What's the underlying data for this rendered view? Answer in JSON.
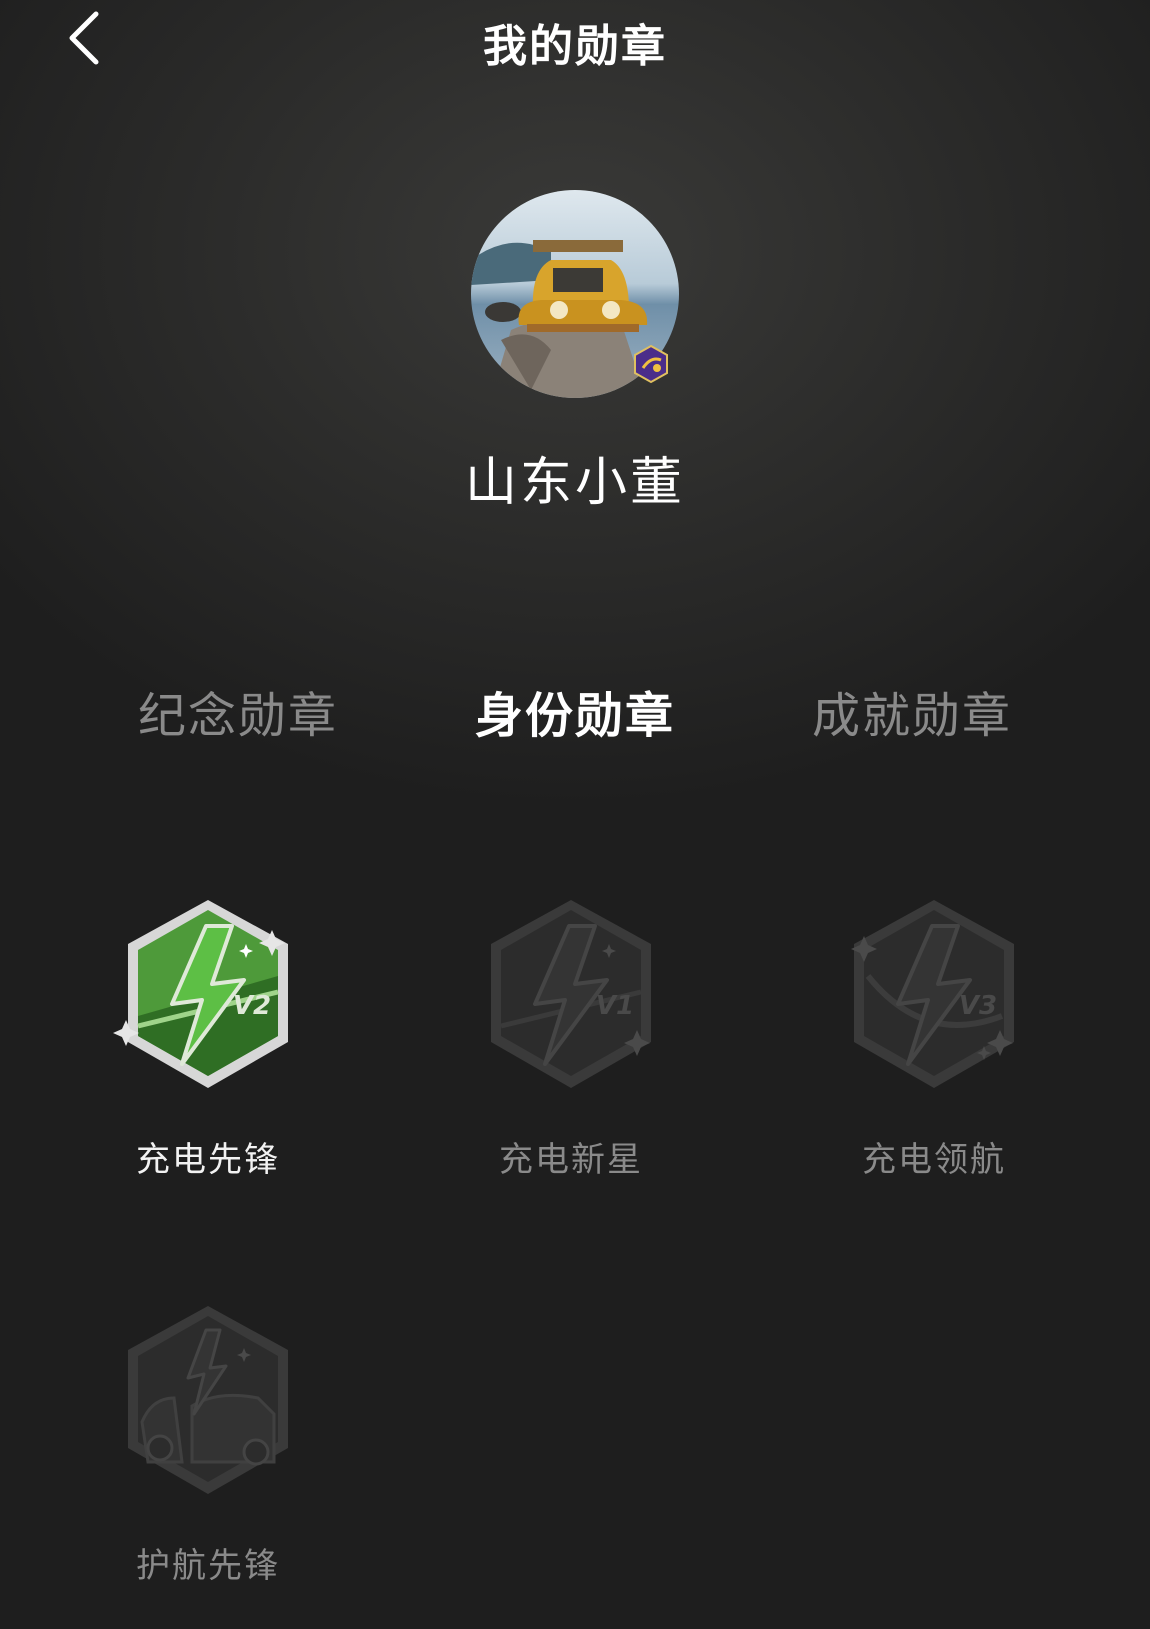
{
  "header": {
    "title": "我的勋章"
  },
  "profile": {
    "username": "山东小董"
  },
  "tabs": [
    {
      "label": "纪念勋章",
      "active": false
    },
    {
      "label": "身份勋章",
      "active": true
    },
    {
      "label": "成就勋章",
      "active": false
    }
  ],
  "badges": [
    {
      "label": "充电先锋",
      "level": "V2",
      "earned": true,
      "icon": "lightning-badge-icon"
    },
    {
      "label": "充电新星",
      "level": "V1",
      "earned": false,
      "icon": "lightning-badge-icon"
    },
    {
      "label": "充电领航",
      "level": "V3",
      "earned": false,
      "icon": "lightning-badge-icon"
    },
    {
      "label": "护航先锋",
      "earned": false,
      "icon": "car-lightning-badge-icon"
    }
  ],
  "colors": {
    "background": "#1e1e1e",
    "active_tab": "#ffffff",
    "inactive_tab": "#8a8a8a",
    "earned_badge": "#3e8a2e"
  }
}
